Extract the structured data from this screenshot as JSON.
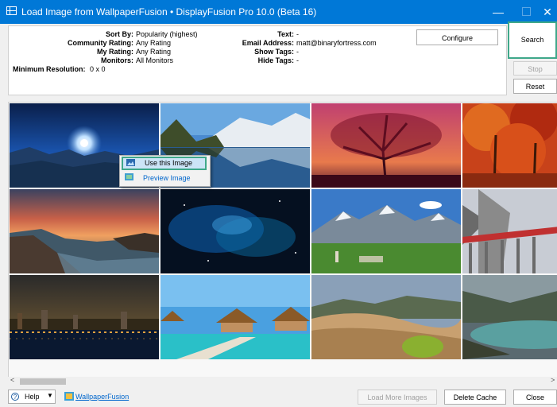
{
  "window": {
    "title": "Load Image from WallpaperFusion • DisplayFusion Pro 10.0 (Beta 16)",
    "minimize": "—",
    "close": "✕"
  },
  "info": {
    "sort_by_label": "Sort By:",
    "sort_by_value": "Popularity (highest)",
    "community_rating_label": "Community Rating:",
    "community_rating_value": "Any Rating",
    "my_rating_label": "My Rating:",
    "my_rating_value": "Any Rating",
    "monitors_label": "Monitors:",
    "monitors_value": "All Monitors",
    "min_resolution_label": "Minimum Resolution:",
    "min_resolution_value": "0 x 0",
    "text_label": "Text:",
    "text_value": "-",
    "email_label": "Email Address:",
    "email_value": "matt@binaryfortress.com",
    "show_tags_label": "Show Tags:",
    "show_tags_value": "-",
    "hide_tags_label": "Hide Tags:",
    "hide_tags_value": "-"
  },
  "buttons": {
    "configure": "Configure",
    "search": "Search",
    "stop": "Stop",
    "reset": "Reset",
    "help": "Help",
    "load_more": "Load More Images",
    "delete_cache": "Delete Cache",
    "close": "Close"
  },
  "context_menu": {
    "use_image": "Use this Image",
    "preview_image": "Preview Image"
  },
  "links": {
    "wallpaperfusion": "WallpaperFusion"
  },
  "icons": {
    "help": "question-circle-icon",
    "dropdown": "chevron-down-icon",
    "wallpaperfusion": "wallpaperfusion-icon",
    "use_image": "image-icon",
    "preview_image": "preview-icon",
    "scroll_left": "<",
    "scroll_right": ">"
  },
  "colors": {
    "titlebar": "#0078d7",
    "highlight_border": "#3fa88a",
    "link": "#0066cc"
  }
}
